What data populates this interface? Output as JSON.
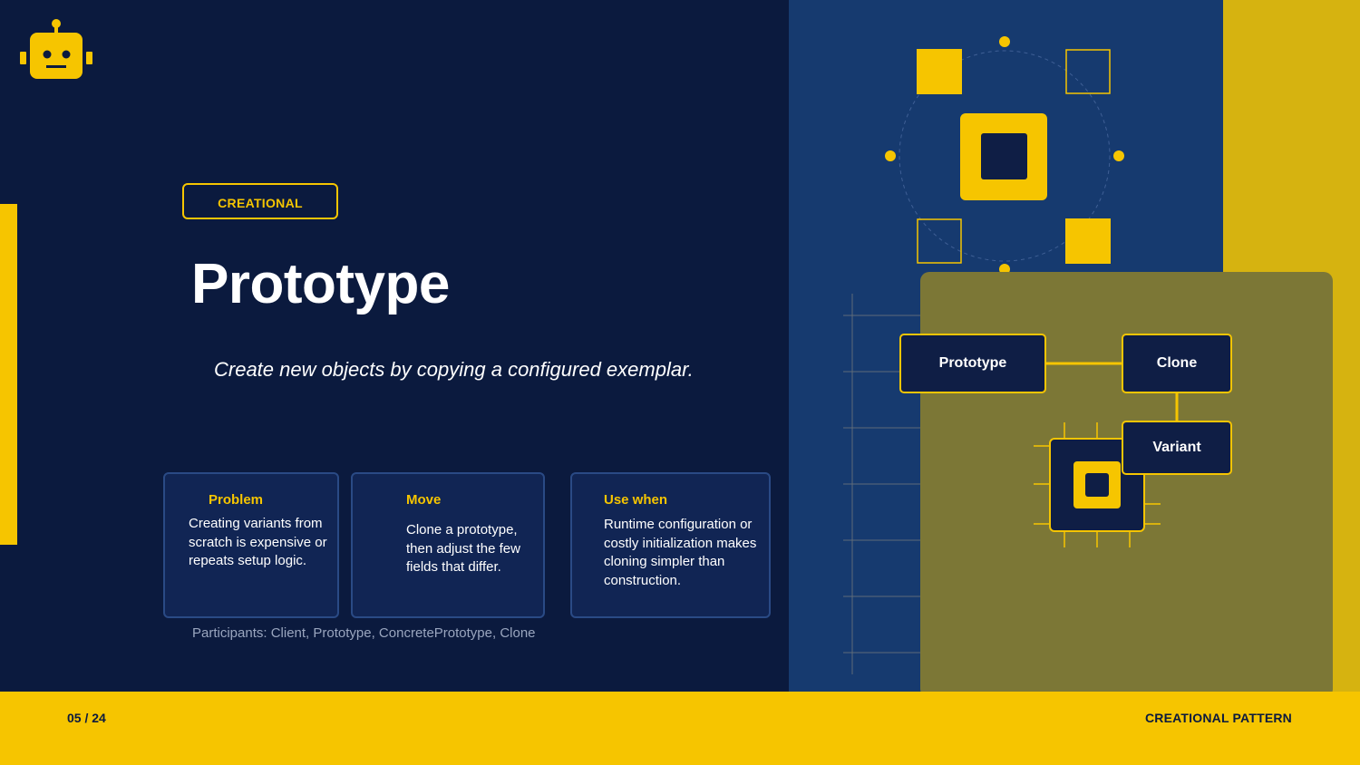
{
  "slide": {
    "tag": "CREATIONAL",
    "title": "Prototype",
    "subtitle": "Create new objects by copying a configured exemplar.",
    "cards": [
      {
        "heading": "Problem",
        "body": "Creating variants from scratch is expensive or repeats setup logic."
      },
      {
        "heading": "Move",
        "body": "Clone a prototype, then adjust the few fields that differ."
      },
      {
        "heading": "Use when",
        "body": "Runtime configuration or costly initialization makes cloning simpler than construction."
      }
    ],
    "participants": "Participants: Client, Prototype, ConcretePrototype, Clone"
  },
  "diagram": {
    "nodes": [
      "Prototype",
      "Clone",
      "Variant"
    ]
  },
  "footer": {
    "page": "05 / 24",
    "section": "CREATIONAL PATTERN"
  },
  "icons": {
    "logo": "robot-icon",
    "chip": "chip-icon"
  },
  "colors": {
    "background": "#0b1a3e",
    "accent": "#f6c500",
    "panel_blue": "#163a6f",
    "panel_gold": "#d6b310",
    "panel_olive": "#7c7736",
    "card": "#112554"
  }
}
